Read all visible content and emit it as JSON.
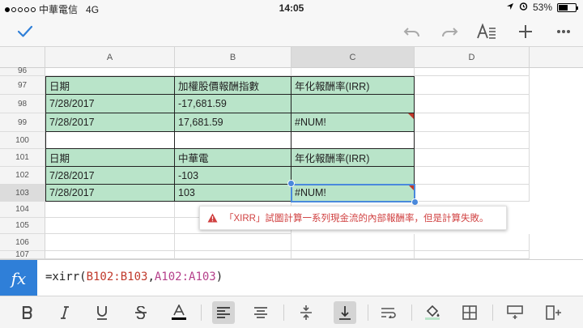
{
  "status": {
    "carrier": "中華電信",
    "network": "4G",
    "time": "14:05",
    "battery": "53%",
    "battery_level": 0.53
  },
  "toolbar": {
    "done_icon": "checkmark-icon",
    "undo_icon": "undo-icon",
    "redo_icon": "redo-icon",
    "format_icon": "text-format-icon",
    "add_icon": "plus-icon",
    "more_icon": "more-icon"
  },
  "columns": [
    "A",
    "B",
    "C",
    "D"
  ],
  "rows": [
    "96",
    "97",
    "98",
    "99",
    "100",
    "101",
    "102",
    "103",
    "104",
    "105",
    "106",
    "107"
  ],
  "cells": {
    "r97": {
      "a": "日期",
      "b": "加權股價報酬指數",
      "c": "年化報酬率(IRR)"
    },
    "r98": {
      "a": "7/28/2017",
      "b": "-17,681.59",
      "c": ""
    },
    "r99": {
      "a": "7/28/2017",
      "b": "17,681.59",
      "c": "#NUM!"
    },
    "r101": {
      "a": "日期",
      "b": "中華電",
      "c": "年化報酬率(IRR)"
    },
    "r102": {
      "a": "7/28/2017",
      "b": "-103",
      "c": ""
    },
    "r103": {
      "a": "7/28/2017",
      "b": "103",
      "c": "#NUM!"
    }
  },
  "error_tooltip": "「XIRR」試圖計算一系列現金流的內部報酬率，但是計算失敗。",
  "formula": {
    "fx_label": "fx",
    "prefix": "=xirr(",
    "ref1": "B102:B103",
    "comma": ",",
    "ref2": "A102:A103",
    "suffix": ")"
  },
  "colors": {
    "cell_fill": "#b9e4c9",
    "selection": "#4a89dc",
    "error": "#c0392b",
    "fx_background": "#2f7fd8"
  }
}
